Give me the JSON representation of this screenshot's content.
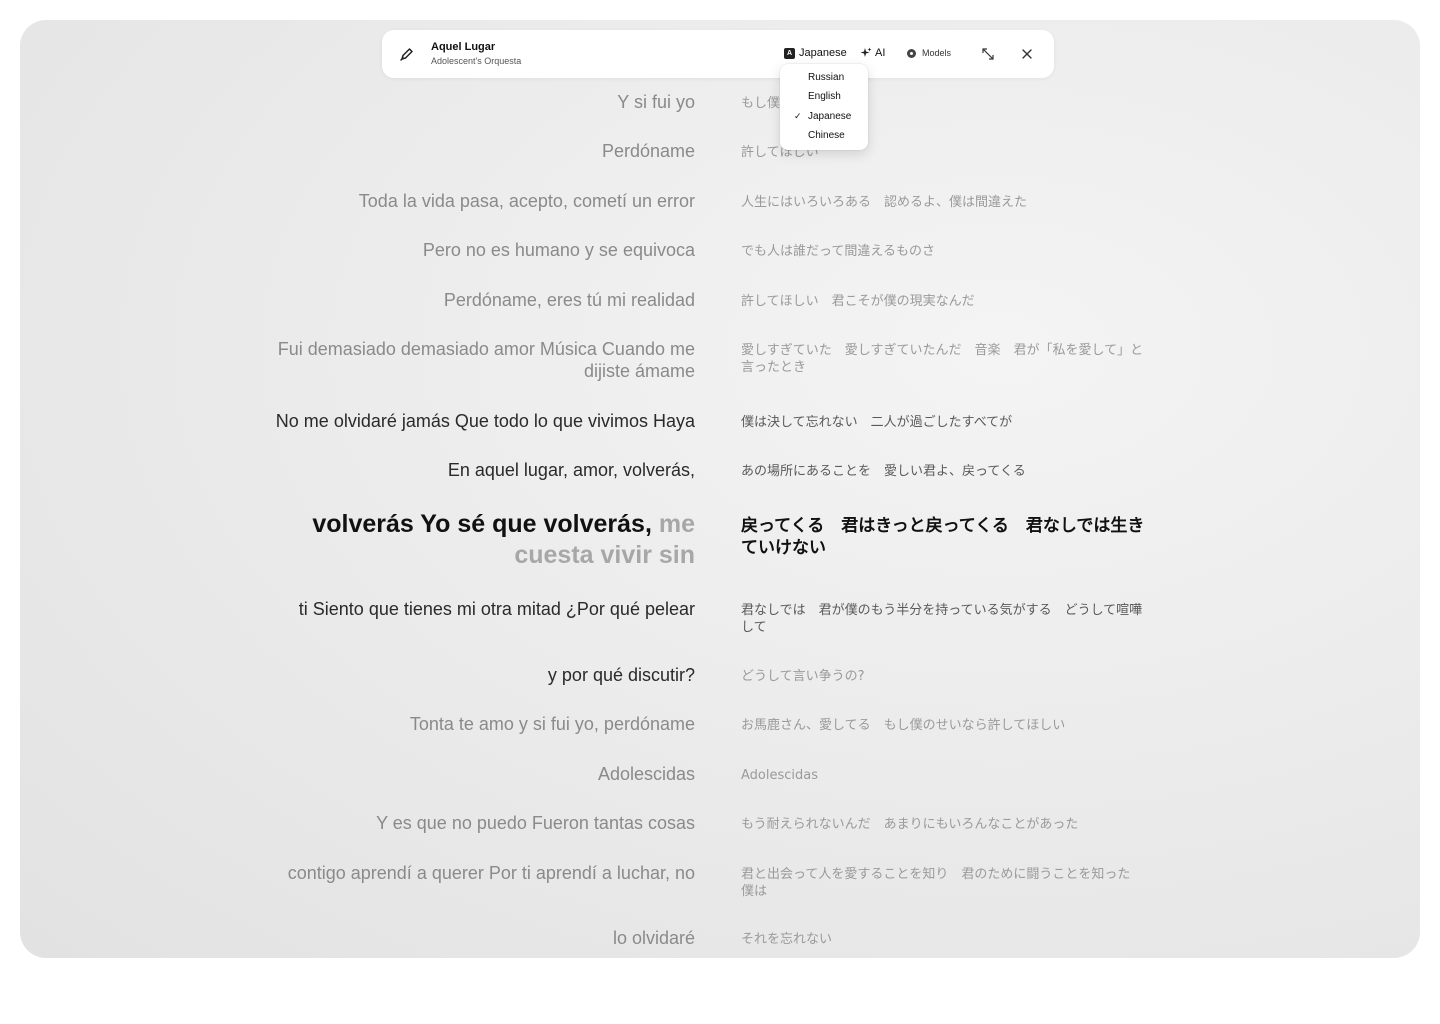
{
  "track": {
    "title": "Aquel Lugar",
    "artist": "Adolescent's Orquesta"
  },
  "toolbar": {
    "language_label": "Japanese",
    "language_icon_glyph": "A",
    "ai_label": "AI",
    "models_label": "Models"
  },
  "language_menu": {
    "selected": "Japanese",
    "options": [
      "Russian",
      "English",
      "Japanese",
      "Chinese"
    ]
  },
  "lyrics": [
    {
      "original": "Y si fui yo",
      "translation": "もし僕のせいなら"
    },
    {
      "original": "Perdóname",
      "translation": "許してほしい"
    },
    {
      "original": "Toda la vida pasa, acepto, cometí un error",
      "translation": "人生にはいろいろある　認めるよ、僕は間違えた"
    },
    {
      "original": "Pero no es humano y se equivoca",
      "translation": "でも人は誰だって間違えるものさ"
    },
    {
      "original": "Perdóname, eres tú mi realidad",
      "translation": "許してほしい　君こそが僕の現実なんだ"
    },
    {
      "original": "Fui demasiado demasiado amor Música Cuando me dijiste ámame",
      "translation": "愛しすぎていた　愛しすぎていたんだ　音楽　君が「私を愛して」と言ったとき"
    },
    {
      "original": "No me olvidaré jamás Que todo lo que vivimos Haya",
      "translation": "僕は決して忘れない　二人が過ごしたすべてが"
    },
    {
      "original": "En aquel lugar, amor, volverás,",
      "translation": "あの場所にあることを　愛しい君よ、戻ってくる"
    },
    {
      "original_sung": "volverás Yo sé que volverás,",
      "original_rest": " me cuesta vivir sin",
      "translation": "戻ってくる　君はきっと戻ってくる　君なしでは生きていけない"
    },
    {
      "original": "ti Siento que tienes mi otra mitad ¿Por qué pelear",
      "translation": "君なしでは　君が僕のもう半分を持っている気がする　どうして喧嘩して"
    },
    {
      "original": "y por qué discutir?",
      "translation": "どうして言い争うの?"
    },
    {
      "original": "Tonta te amo y si fui yo, perdóname",
      "translation": "お馬鹿さん、愛してる　もし僕のせいなら許してほしい"
    },
    {
      "original": "Adolescidas",
      "translation": "Adolescidas"
    },
    {
      "original": "Y es que no puedo Fueron tantas cosas",
      "translation": "もう耐えられないんだ　あまりにもいろんなことがあった"
    },
    {
      "original": "contigo aprendí a querer Por ti aprendí a luchar, no",
      "translation": "君と出会って人を愛することを知り　君のために闘うことを知った　僕は"
    },
    {
      "original": "lo olvidaré",
      "translation": "それを忘れない"
    }
  ]
}
